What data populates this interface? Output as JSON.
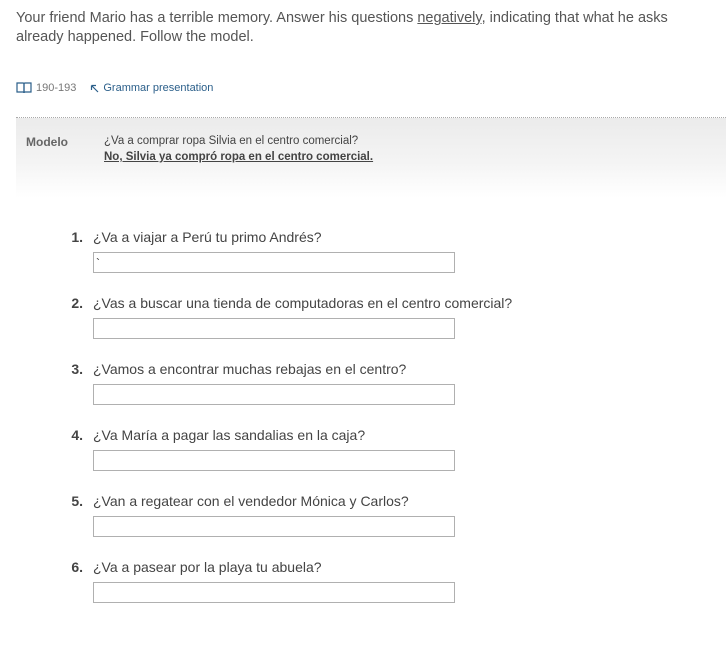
{
  "header": {
    "instructions_pre": "Your friend Mario has a terrible memory. Answer his questions ",
    "instructions_underlined": "negatively",
    "instructions_post": ", indicating that what he asks already happened. Follow the model."
  },
  "references": {
    "book_icon": "book-icon",
    "pages": "190-193",
    "grammar_link_icon": "arrow-up-left-icon",
    "grammar_link": "Grammar presentation"
  },
  "model": {
    "label": "Modelo",
    "question": "¿Va a comprar ropa Silvia en el centro comercial?",
    "answer": "No, Silvia ya compró ropa en el centro comercial."
  },
  "questions": [
    {
      "number": "1.",
      "text": "¿Va a viajar a Perú tu primo Andrés?",
      "answer": "`"
    },
    {
      "number": "2.",
      "text": "¿Vas a buscar una tienda de computadoras en el centro comercial?",
      "answer": ""
    },
    {
      "number": "3.",
      "text": "¿Vamos a encontrar muchas rebajas en el centro?",
      "answer": ""
    },
    {
      "number": "4.",
      "text": "¿Va María a pagar las sandalias en la caja?",
      "answer": ""
    },
    {
      "number": "5.",
      "text": "¿Van a regatear con el vendedor Mónica y Carlos?",
      "answer": ""
    },
    {
      "number": "6.",
      "text": "¿Va a pasear por la playa tu abuela?",
      "answer": ""
    }
  ]
}
